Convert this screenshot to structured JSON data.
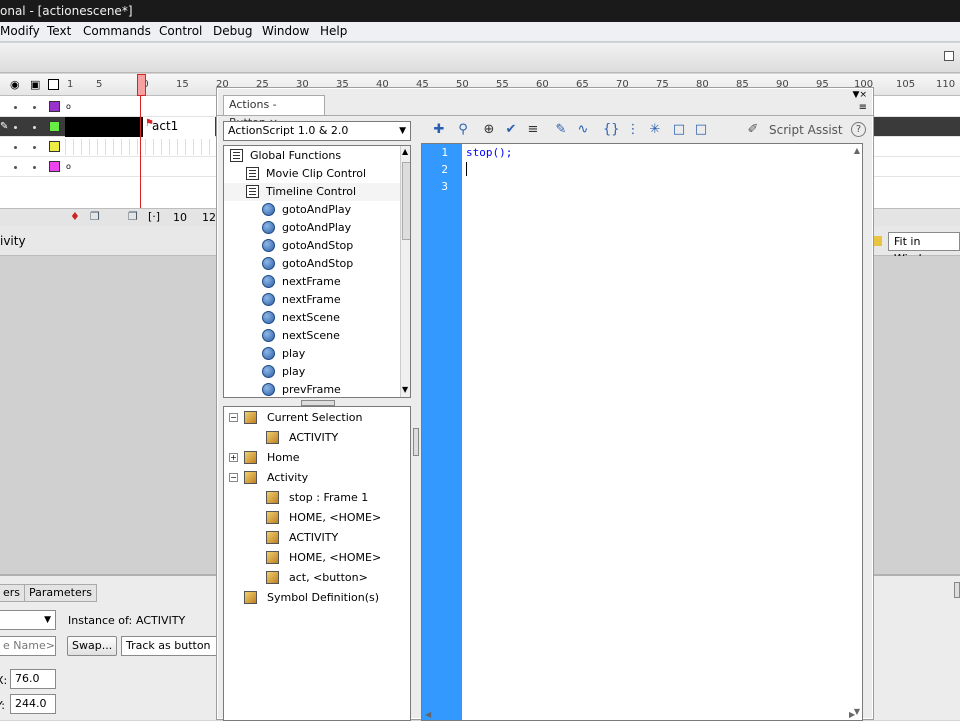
{
  "window": {
    "title": "onal - [actionescene*]"
  },
  "menu": [
    "Modify",
    "Text",
    "Commands",
    "Control",
    "Debug",
    "Window",
    "Help"
  ],
  "timeline": {
    "ruler": [
      "1",
      "5",
      "10",
      "15",
      "20",
      "25",
      "30",
      "35",
      "40",
      "45",
      "50",
      "55",
      "60",
      "65",
      "70",
      "75",
      "80",
      "85",
      "90",
      "95",
      "100",
      "105",
      "110"
    ],
    "layer_label": "act1",
    "footer": {
      "frame": "10",
      "fps": "12."
    }
  },
  "stagebar": {
    "left_label": "ivity",
    "zoom": "Fit in Window"
  },
  "properties": {
    "tabs": [
      "ers",
      "Parameters"
    ],
    "instance_label": "Instance of:",
    "instance_value": "ACTIVITY",
    "name_placeholder": "e Name>",
    "swap_button": "Swap...",
    "track_select": "Track as button",
    "x_label": "X:",
    "x_value": "76.0",
    "y_label": "Y:",
    "y_value": "244.0"
  },
  "actions": {
    "tab_label": "Actions - Button",
    "language": "ActionScript 1.0 & 2.0",
    "script_assist": "Script Assist",
    "toolbox": [
      {
        "label": "Global Functions",
        "kind": "book",
        "indent": 0
      },
      {
        "label": "Movie Clip Control",
        "kind": "book",
        "indent": 1
      },
      {
        "label": "Timeline Control",
        "kind": "book",
        "indent": 1
      },
      {
        "label": "gotoAndPlay",
        "kind": "circle",
        "indent": 2
      },
      {
        "label": "gotoAndPlay",
        "kind": "circle",
        "indent": 2
      },
      {
        "label": "gotoAndStop",
        "kind": "circle",
        "indent": 2
      },
      {
        "label": "gotoAndStop",
        "kind": "circle",
        "indent": 2
      },
      {
        "label": "nextFrame",
        "kind": "circle",
        "indent": 2
      },
      {
        "label": "nextFrame",
        "kind": "circle",
        "indent": 2
      },
      {
        "label": "nextScene",
        "kind": "circle",
        "indent": 2
      },
      {
        "label": "nextScene",
        "kind": "circle",
        "indent": 2
      },
      {
        "label": "play",
        "kind": "circle",
        "indent": 2
      },
      {
        "label": "play",
        "kind": "circle",
        "indent": 2
      },
      {
        "label": "prevFrame",
        "kind": "circle",
        "indent": 2
      }
    ],
    "navigator": [
      {
        "label": "Current Selection",
        "indent": 0,
        "expander": "−"
      },
      {
        "label": "ACTIVITY",
        "indent": 1,
        "expander": ""
      },
      {
        "label": "Home",
        "indent": 0,
        "expander": "+"
      },
      {
        "label": "Activity",
        "indent": 0,
        "expander": "−"
      },
      {
        "label": "stop : Frame 1",
        "indent": 1,
        "expander": ""
      },
      {
        "label": "HOME, <HOME>",
        "indent": 1,
        "expander": ""
      },
      {
        "label": "ACTIVITY",
        "indent": 1,
        "expander": ""
      },
      {
        "label": "HOME, <HOME>",
        "indent": 1,
        "expander": ""
      },
      {
        "label": "act, <button>",
        "indent": 1,
        "expander": ""
      },
      {
        "label": "Symbol Definition(s)",
        "indent": 0,
        "expander": ""
      }
    ],
    "code_lines": [
      "1",
      "2",
      "3"
    ],
    "code": "stop();"
  }
}
